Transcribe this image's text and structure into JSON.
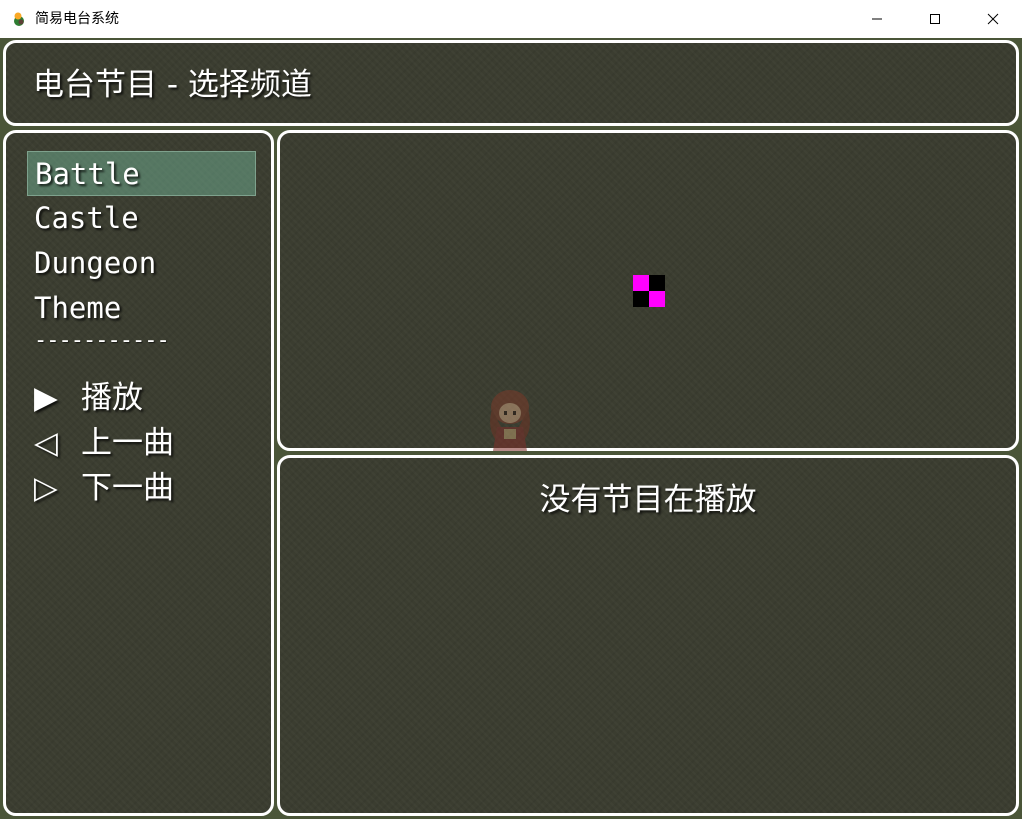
{
  "window": {
    "title": "简易电台系统",
    "controls": {
      "minimize_icon": "minimize-icon",
      "maximize_icon": "maximize-icon",
      "close_icon": "close-icon"
    }
  },
  "header": {
    "title": "电台节目 - 选择频道"
  },
  "channels": {
    "items": [
      {
        "label": "Battle",
        "selected": true
      },
      {
        "label": "Castle",
        "selected": false
      },
      {
        "label": "Dungeon",
        "selected": false
      },
      {
        "label": "Theme",
        "selected": false
      }
    ],
    "separator": "-----------"
  },
  "commands": [
    {
      "glyph": "▶",
      "label": "播放",
      "icon": "play-icon"
    },
    {
      "glyph": "◁",
      "label": "上一曲",
      "icon": "previous-icon"
    },
    {
      "glyph": "▷",
      "label": "下一曲",
      "icon": "next-icon"
    }
  ],
  "status": {
    "text": "没有节目在播放"
  },
  "colors": {
    "panel_border": "#ffffff",
    "panel_background": "#3b3d30",
    "selection_highlight": "#5f8a73",
    "missing_texture": [
      "#ff00ff",
      "#000000"
    ]
  }
}
